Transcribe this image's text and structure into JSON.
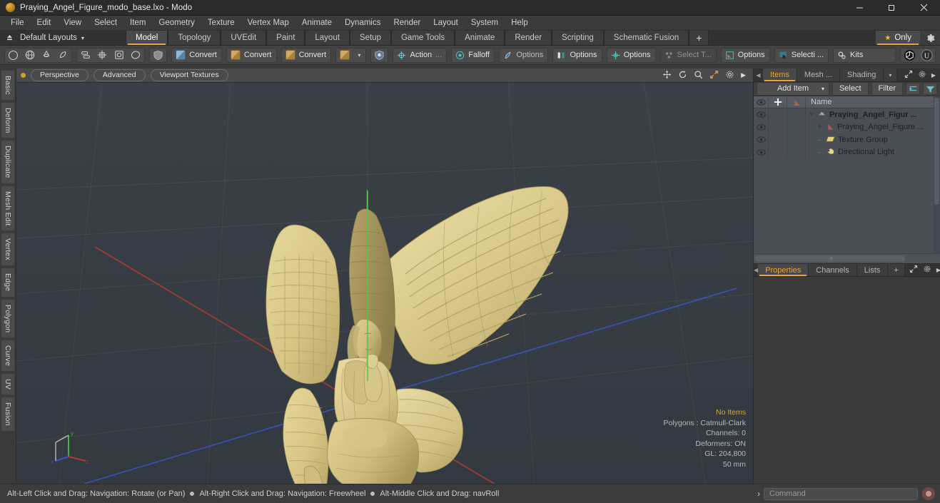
{
  "window": {
    "title": "Praying_Angel_Figure_modo_base.lxo - Modo",
    "app_icon": "modo-orb-icon",
    "minimize": "–",
    "maximize": "❐",
    "close": "✕"
  },
  "menubar": {
    "items": [
      "File",
      "Edit",
      "View",
      "Select",
      "Item",
      "Geometry",
      "Texture",
      "Vertex Map",
      "Animate",
      "Dynamics",
      "Render",
      "Layout",
      "System",
      "Help"
    ]
  },
  "layoutbar": {
    "default_layouts": "Default Layouts",
    "caret": "▾",
    "tabs": [
      {
        "label": "Model",
        "active": true
      },
      {
        "label": "Topology",
        "active": false
      },
      {
        "label": "UVEdit",
        "active": false
      },
      {
        "label": "Paint",
        "active": false
      },
      {
        "label": "Layout",
        "active": false
      },
      {
        "label": "Setup",
        "active": false
      },
      {
        "label": "Game Tools",
        "active": false
      },
      {
        "label": "Animate",
        "active": false
      },
      {
        "label": "Render",
        "active": false
      },
      {
        "label": "Scripting",
        "active": false
      },
      {
        "label": "Schematic Fusion",
        "active": false
      }
    ],
    "add_tab": "+",
    "only_button": "Only",
    "only_star": "★",
    "settings_icon": "gear-icon"
  },
  "toolbar": {
    "groups": [
      {
        "name": "primitives",
        "buttons": [
          {
            "icon": "circle-icon",
            "label": ""
          },
          {
            "icon": "globe-icon",
            "label": ""
          },
          {
            "icon": "cone-icon",
            "label": ""
          },
          {
            "icon": "teardrop-icon",
            "label": ""
          }
        ]
      },
      {
        "name": "arrange",
        "buttons": [
          {
            "icon": "stack-icon",
            "label": ""
          },
          {
            "icon": "crosshair-box-icon",
            "label": ""
          },
          {
            "icon": "target-box-icon",
            "label": ""
          },
          {
            "icon": "ellipse-icon",
            "label": ""
          }
        ]
      },
      {
        "name": "shield",
        "buttons": [
          {
            "icon": "shield-icon",
            "label": ""
          }
        ]
      },
      {
        "name": "convert-1",
        "buttons": [
          {
            "icon": "cube-blue-icon",
            "label": "Convert"
          }
        ]
      },
      {
        "name": "convert-2",
        "buttons": [
          {
            "icon": "cube-tan-icon",
            "label": "Convert"
          }
        ]
      },
      {
        "name": "convert-3",
        "buttons": [
          {
            "icon": "cube-tan-icon",
            "label": "Convert"
          }
        ]
      },
      {
        "name": "convert-dropdown",
        "buttons": [
          {
            "icon": "cube-tan-icon",
            "label": ""
          },
          {
            "icon": "chevron-down-icon",
            "label": ""
          }
        ]
      },
      {
        "name": "shield-blue",
        "buttons": [
          {
            "icon": "shield-globe-icon",
            "label": ""
          }
        ]
      },
      {
        "name": "action",
        "buttons": [
          {
            "icon": "action-center-icon",
            "label": "Action"
          },
          {
            "icon": "ellipsis-icon",
            "label": "..."
          }
        ]
      },
      {
        "name": "falloff",
        "buttons": [
          {
            "icon": "falloff-icon",
            "label": "Falloff"
          }
        ]
      },
      {
        "name": "options-1",
        "buttons": [
          {
            "icon": "snap-icon",
            "label": "Options"
          }
        ]
      },
      {
        "name": "options-2",
        "buttons": [
          {
            "icon": "symmetry-icon",
            "label": "Options"
          }
        ]
      },
      {
        "name": "options-3",
        "buttons": [
          {
            "icon": "workplane-icon",
            "label": "Options"
          }
        ]
      },
      {
        "name": "select-through",
        "buttons": [
          {
            "icon": "select-through-icon",
            "label": "Select T..."
          }
        ],
        "disabled": true
      },
      {
        "name": "options-4",
        "buttons": [
          {
            "icon": "element-options-icon",
            "label": "Options"
          }
        ]
      },
      {
        "name": "selection-sets",
        "buttons": [
          {
            "icon": "selection-icon",
            "label": "Selecti ..."
          }
        ]
      },
      {
        "name": "kits",
        "buttons": [
          {
            "icon": "kits-gear-icon",
            "label": "Kits"
          }
        ]
      },
      {
        "name": "engines",
        "buttons": [
          {
            "icon": "unity-icon",
            "label": ""
          },
          {
            "icon": "unreal-icon",
            "label": ""
          }
        ]
      }
    ]
  },
  "left_sidebar": {
    "tabs": [
      "Basic",
      "Deform",
      "Duplicate",
      "Mesh Edit",
      "Vertex",
      "Edge",
      "Polygon",
      "Curve",
      "UV",
      "Fusion"
    ]
  },
  "viewport": {
    "header": {
      "dot": "active-dot",
      "buttons": [
        "Perspective",
        "Advanced",
        "Viewport Textures"
      ],
      "icons": [
        "pan-icon",
        "rotate-icon",
        "zoom-icon",
        "fit-icon",
        "gear-icon",
        "chevron-right-icon"
      ]
    },
    "stats": {
      "selection": "No Items",
      "polygons": "Polygons : Catmull-Clark",
      "channels": "Channels: 0",
      "deformers": "Deformers: ON",
      "gl": "GL: 204,800",
      "scale": "50 mm"
    },
    "model": {
      "name": "praying-angel-figure",
      "surface_color": "#d8c98a",
      "shadow_color": "#a99a5e"
    },
    "background_color": "#363d42",
    "axis_colors": {
      "x": "#b03a35",
      "y": "#46b244",
      "z": "#3a55c0"
    },
    "gizmo_labels": {
      "x": "x",
      "y": "y",
      "z": "z"
    }
  },
  "right_panel": {
    "top_tabs": [
      {
        "label": "Items",
        "active": true
      },
      {
        "label": "Mesh ...",
        "active": false
      },
      {
        "label": "Shading",
        "active": false
      }
    ],
    "top_tab_caret": "▾",
    "top_icons": [
      "expand-icon",
      "gear-icon",
      "chevron-right-icon"
    ],
    "controls": {
      "add_item": "Add Item",
      "add_item_caret": "▾",
      "select": "Select",
      "filter": "Filter",
      "icons": [
        "list-toggle-icon",
        "funnel-icon"
      ]
    },
    "item_list": {
      "columns": [
        "eye-icon",
        "plus-icon",
        "shading-icon",
        "Name"
      ],
      "rows": [
        {
          "name": "Praying_Angel_Figur ...",
          "icon": "mesh-group-icon",
          "indent": 0,
          "bold": true,
          "expander": "down",
          "visible": true
        },
        {
          "name": "Praying_Angel_Figure ...",
          "icon": "mesh-icon",
          "indent": 1,
          "bold": false,
          "expander": "right",
          "visible": true
        },
        {
          "name": "Texture Group",
          "icon": "texture-group-icon",
          "indent": 1,
          "bold": false,
          "expander": "none",
          "visible": true
        },
        {
          "name": "Directional Light",
          "icon": "light-icon",
          "indent": 1,
          "bold": false,
          "expander": "none",
          "visible": true
        }
      ]
    },
    "bottom_tabs": [
      {
        "label": "Properties",
        "active": true
      },
      {
        "label": "Channels",
        "active": false
      },
      {
        "label": "Lists",
        "active": false
      }
    ],
    "bottom_tab_add": "+",
    "bottom_icons": [
      "expand-icon",
      "gear-icon",
      "chevron-right-icon"
    ]
  },
  "statusbar": {
    "hints": [
      "Alt-Left Click and Drag: Navigation: Rotate (or Pan)",
      "Alt-Right Click and Drag: Navigation: Freewheel",
      "Alt-Middle Click and Drag: navRoll"
    ],
    "command_prompt": "›",
    "command_placeholder": "Command",
    "record_icon": "record-icon"
  }
}
